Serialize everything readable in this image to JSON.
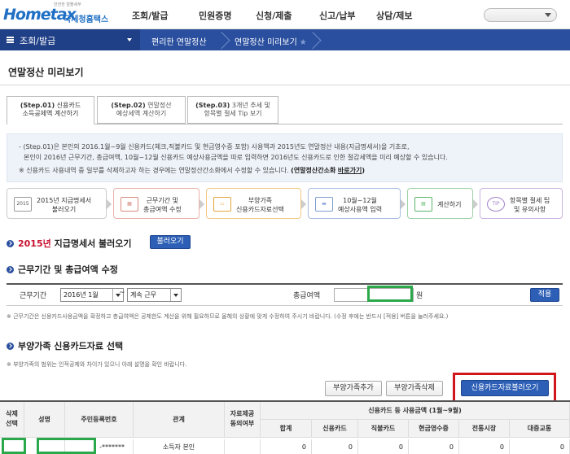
{
  "header": {
    "logo_sub": "안전한 알뜰세무",
    "logo_main": "Hometax",
    "logo_kr": "국세청홈택스",
    "nav": [
      "조회/발급",
      "민원증명",
      "신청/제출",
      "신고/납부",
      "상담/제보"
    ]
  },
  "breadcrumb": {
    "menu": "조회/발급",
    "items": [
      "편리한 연말정산",
      "연말정산 미리보기"
    ]
  },
  "page": {
    "title": "연말정산 미리보기"
  },
  "tabs": [
    {
      "step": "(Step.01)",
      "line1": "신용카드",
      "line2": "소득공제액 계산하기"
    },
    {
      "step": "(Step.02)",
      "line1": "연말정산",
      "line2": "예상세액 계산하기"
    },
    {
      "step": "(Step.03)",
      "line1": "3개년 추세 및",
      "line2": "항목별 절세 Tip 보기"
    }
  ],
  "info": {
    "line1": "(Step.01)은 본인의 2016.1월~9월 신용카드(체크,직불카드 및 현금영수증 포함) 사용액과 2015년도 연말정산 내용(지급명세서)을 기초로,",
    "line2": "본인이 2016년 근무기간, 총급여액, 10월~12월 신용카드 예상사용금액을 따로 입력하면 2016년도 신용카드로 인한 절감세액을 미리 예상할 수 있습니다.",
    "line3": "※ 신용카드 사용내역 중 일부를 삭제하고자 하는 경우에는 연말정산간소화에서 수정할 수 있습니다.",
    "line3_bold": "(연말정산간소화",
    "line3_link": "바로가기",
    "line3_end": ")"
  },
  "flow": [
    {
      "icon": "2015",
      "line1": "2015년 지급명세서",
      "line2": "불러오기"
    },
    {
      "icon": "cal",
      "line1": "근무기간 및",
      "line2": "총급여액 수정"
    },
    {
      "icon": "dep",
      "line1": "부양가족",
      "line2": "신용카드자료선택"
    },
    {
      "icon": "card",
      "line1": "10월~12월",
      "line2": "예상사용액 입력"
    },
    {
      "icon": "calc",
      "line1": "계산하기",
      "line2": ""
    },
    {
      "icon": "TIP",
      "line1": "항목별 절세 팁",
      "line2": "및 유의사항"
    }
  ],
  "sections": {
    "s1_year": "2015년",
    "s1_rest": "지급명세서 불러오기",
    "s1_button": "불러오기",
    "s2": "근무기간 및 총급여액 수정",
    "s3": "부양가족 신용카드자료 선택"
  },
  "work": {
    "label_period": "근무기간",
    "start": "2016년 1월",
    "tilde": "~",
    "end": "계속 근무",
    "label_salary": "총급여액",
    "unit": "원",
    "apply": "적용"
  },
  "notes": {
    "n1": "※ 근무기간은 신용카드사용금액을 확정하고 총급여액은 공제한도 계산을 위해 필요하므로 올해의 상황에 맞게 수정하여 주시기 바랍니다. (수정 후에는 반드시 [적용] 버튼을 눌러주세요.)",
    "n2": "※ 부양가족의 범위는 인적공제와 차이가 있으니 아래 설명을 확인 바랍니다."
  },
  "buttons": {
    "add": "부양가족추가",
    "delete": "부양가족삭제",
    "load_card": "신용카드자료불러오기"
  },
  "table": {
    "headers": {
      "delete": "삭제\n선택",
      "name": "성명",
      "rrn": "주민등록번호",
      "relation": "관계",
      "consent": "자료제공\n동의여부",
      "group": "신용카드 등 사용금액 (1월~9월)",
      "cols": [
        "합계",
        "신용카드",
        "직불카드",
        "현금영수증",
        "전통시장",
        "대중교통"
      ]
    },
    "row": {
      "rrn_mask": "-*******",
      "relation": "소득자 본인",
      "values": [
        "0",
        "0",
        "0",
        "0",
        "0",
        "0"
      ]
    }
  }
}
